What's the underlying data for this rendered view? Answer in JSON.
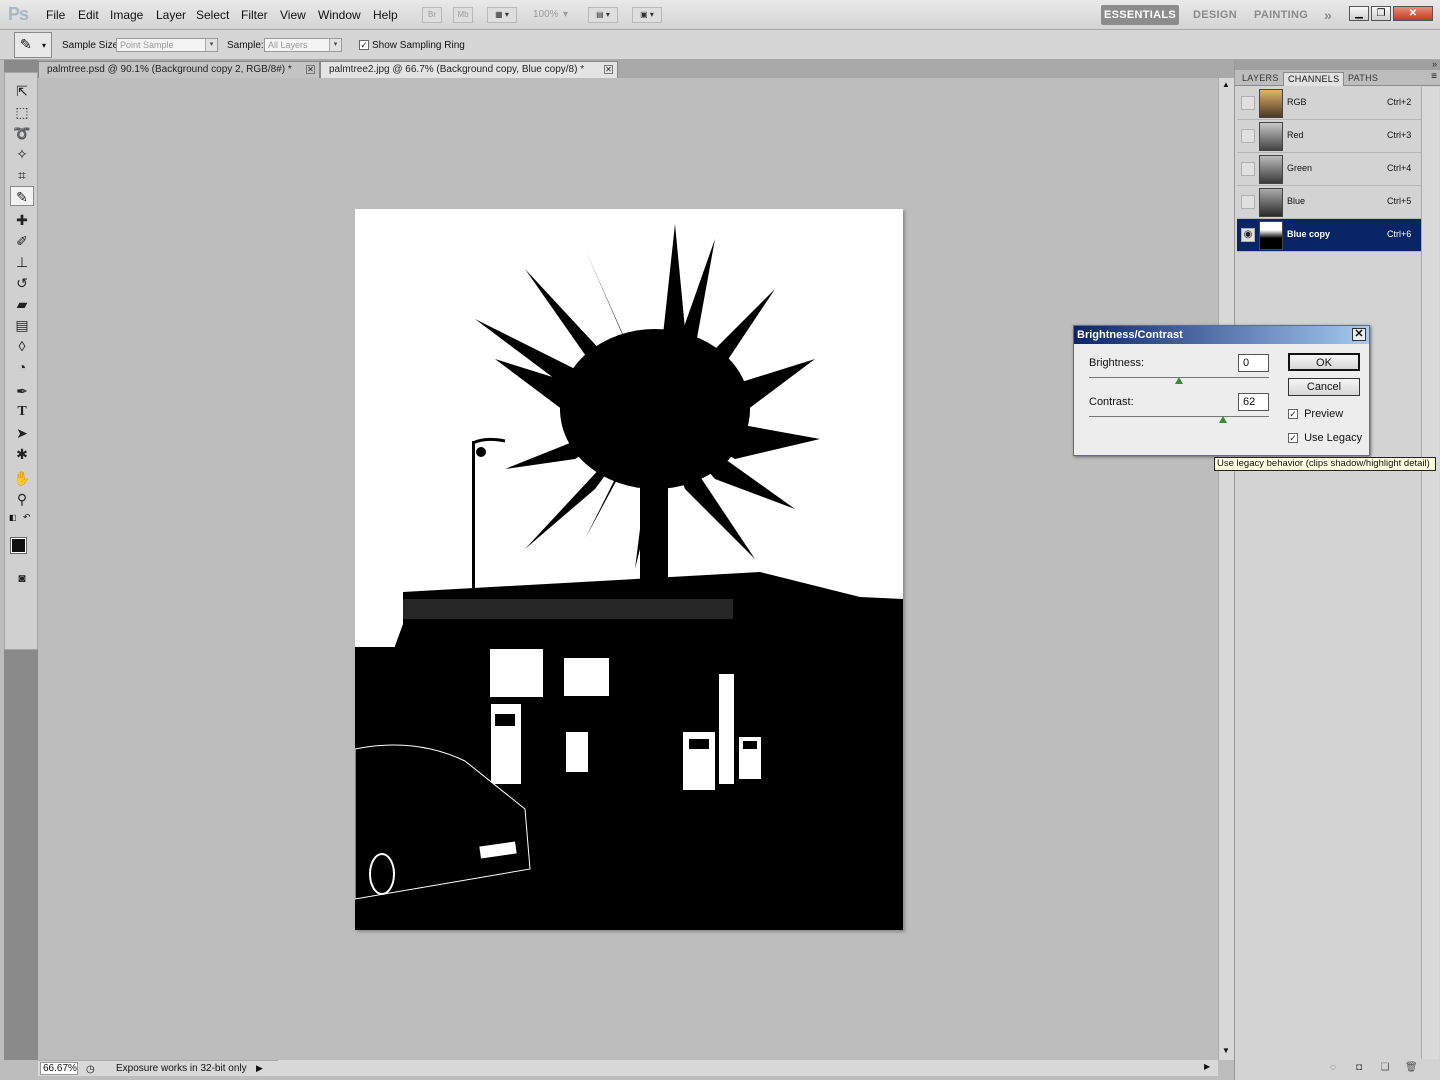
{
  "app": {
    "logo": "Ps",
    "menu": [
      "File",
      "Edit",
      "Image",
      "Layer",
      "Select",
      "Filter",
      "View",
      "Window",
      "Help"
    ],
    "bridge_btn": "Br",
    "minibridge_btn": "Mb",
    "zoom_combo": "100%",
    "workspaces": [
      "ESSENTIALS",
      "DESIGN",
      "PAINTING"
    ],
    "workspace_more": "»"
  },
  "options": {
    "sample_size_label": "Sample Size:",
    "sample_size_value": "Point Sample",
    "sample_label": "Sample:",
    "sample_value": "All Layers",
    "show_ring_label": "Show Sampling Ring",
    "show_ring_checked": "✓"
  },
  "tabs": [
    {
      "label": "palmtree.psd @ 90.1% (Background copy 2, RGB/8#) *"
    },
    {
      "label": "palmtree2.jpg @ 66.7% (Background copy, Blue copy/8) *"
    }
  ],
  "status": {
    "zoom": "66.67%",
    "message": "Exposure works in 32-bit only"
  },
  "panel": {
    "tabs": [
      "LAYERS",
      "CHANNELS",
      "PATHS"
    ],
    "channels": [
      {
        "name": "RGB",
        "shortcut": "Ctrl+2",
        "visible": false
      },
      {
        "name": "Red",
        "shortcut": "Ctrl+3",
        "visible": false
      },
      {
        "name": "Green",
        "shortcut": "Ctrl+4",
        "visible": false
      },
      {
        "name": "Blue",
        "shortcut": "Ctrl+5",
        "visible": false
      },
      {
        "name": "Blue copy",
        "shortcut": "Ctrl+6",
        "visible": true
      }
    ]
  },
  "dialog": {
    "title": "Brightness/Contrast",
    "brightness_label": "Brightness:",
    "brightness_value": "0",
    "contrast_label": "Contrast:",
    "contrast_value": "62",
    "ok": "OK",
    "cancel": "Cancel",
    "preview_label": "Preview",
    "legacy_label": "Use Legacy",
    "check_mark": "✓",
    "close": "✕",
    "tooltip": "Use legacy behavior (clips shadow/highlight detail)"
  },
  "colors": {
    "selection": "#0a2566",
    "foreground": "#111111",
    "background": "#111111"
  }
}
